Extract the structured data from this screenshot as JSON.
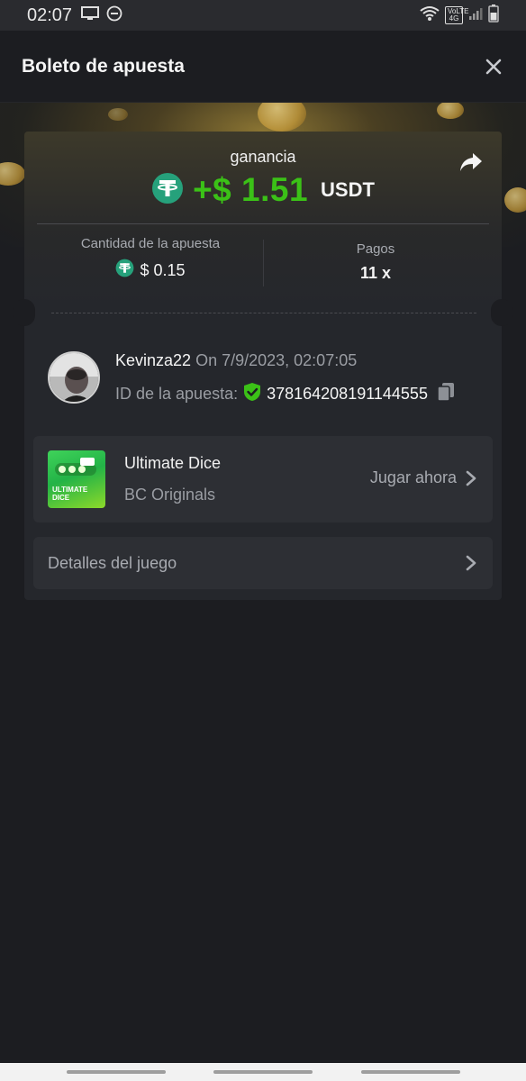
{
  "status_bar": {
    "time": "02:07",
    "carrier_badge": "VoLTE 4G"
  },
  "header": {
    "title": "Boleto de apuesta"
  },
  "win": {
    "label": "ganancia",
    "amount": "+$ 1.51",
    "currency": "USDT"
  },
  "stats": {
    "bet_amount_label": "Cantidad de la apuesta",
    "bet_amount_value": "$ 0.15",
    "payout_label": "Pagos",
    "payout_value": "11 x"
  },
  "user": {
    "username": "Kevinza22",
    "date": "On 7/9/2023, 02:07:05",
    "bet_id_label": "ID de la apuesta:",
    "bet_id": "378164208191144555"
  },
  "game": {
    "title": "Ultimate Dice",
    "provider": "BC Originals",
    "play_label": "Jugar ahora",
    "thumb_text": "ULTIMATE DICE"
  },
  "details": {
    "label": "Detalles del juego"
  },
  "colors": {
    "accent_green": "#3bc117",
    "tether_green": "#26a17b",
    "background": "#1c1d21",
    "card": "#25272c"
  },
  "icons": [
    "tether-icon",
    "share-icon",
    "close-icon",
    "verified-shield-icon",
    "copy-icon",
    "chevron-right-icon"
  ]
}
